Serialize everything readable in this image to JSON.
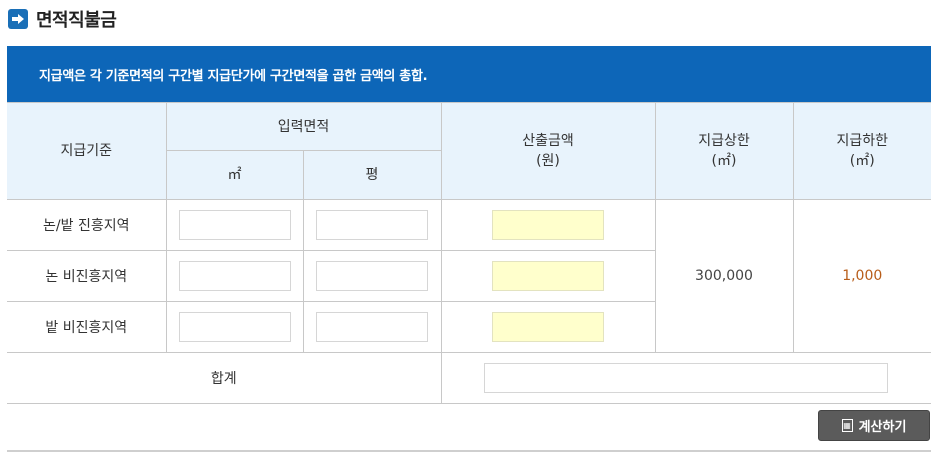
{
  "title": "면적직불금",
  "banner": "지급액은 각 기준면적의 구간별 지급단가에 구간면적을 곱한 금액의 총합.",
  "headers": {
    "criteria": "지급기준",
    "input_area": "입력면적",
    "sqm": "㎡",
    "pyeong": "평",
    "amount_line1": "산출금액",
    "amount_line2": "(원)",
    "max_line1": "지급상한",
    "max_line2": "(㎡)",
    "min_line1": "지급하한",
    "min_line2": "(㎡)"
  },
  "rows": [
    {
      "label": "논/밭 진흥지역"
    },
    {
      "label": "논 비진흥지역"
    },
    {
      "label": "밭 비진흥지역"
    }
  ],
  "max_value": "300,000",
  "min_value": "1,000",
  "total_label": "합계",
  "button_label": "계산하기",
  "colors": {
    "banner": "#0d66b8",
    "header_bg": "#e8f3fc",
    "result_field": "#ffffcc",
    "min_value": "#b85d19",
    "button": "#5b5b5b"
  }
}
